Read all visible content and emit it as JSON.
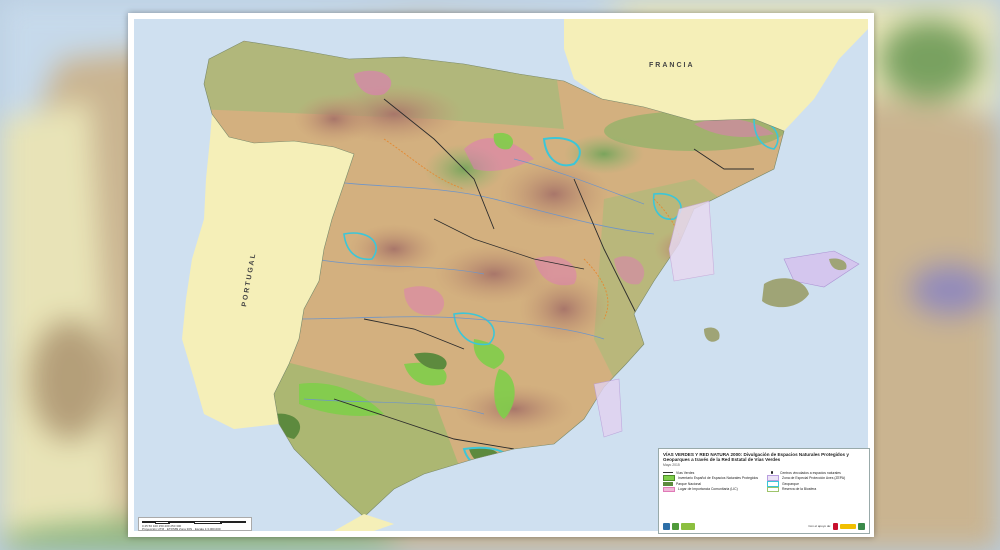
{
  "map": {
    "labels": {
      "francia": "FRANCIA",
      "portugal": "PORTUGAL"
    },
    "colors": {
      "sea": "#cfe0f0",
      "foreign_land": "#f5efb8",
      "terrain_low": "#d8b882",
      "terrain_high": "#b98a5e",
      "green_lowland": "#8ab06a",
      "national_park": "#5d8a3e",
      "protected_area": "#7fce4a",
      "lic_pink": "#e07ab7",
      "zepa_violet": "#b89ee0",
      "geopark_cyan": "#3cc6d8",
      "green_way": "#2b2b2b"
    }
  },
  "legend": {
    "title": "VÍAS VERDES Y RED NATURA 2000: Divulgación de Espacios Naturales Protegidos y Geoparques a través de la Red Estatal de Vías Verdes",
    "subtitle": "Mayo 2015",
    "items_left": [
      "Vías Verdes",
      "Inventario Español de Espacios Naturales Protegidos",
      "Parque Nacional",
      "Lugar de Importancia Comunitaria (LIC)"
    ],
    "items_right": [
      "Centros vinculados a espacios naturales",
      "Zona de Especial Protección Aves (ZEPA)",
      "Geoparque",
      "Reserva de la Biosfera"
    ],
    "logos_caption": "Con el apoyo de:"
  },
  "scale": {
    "ticks": "0 25 50 100 150 200 250 300",
    "note": "Proyección UTM · ETRS89 Zona 30N · Escala 1:3.000.000"
  }
}
